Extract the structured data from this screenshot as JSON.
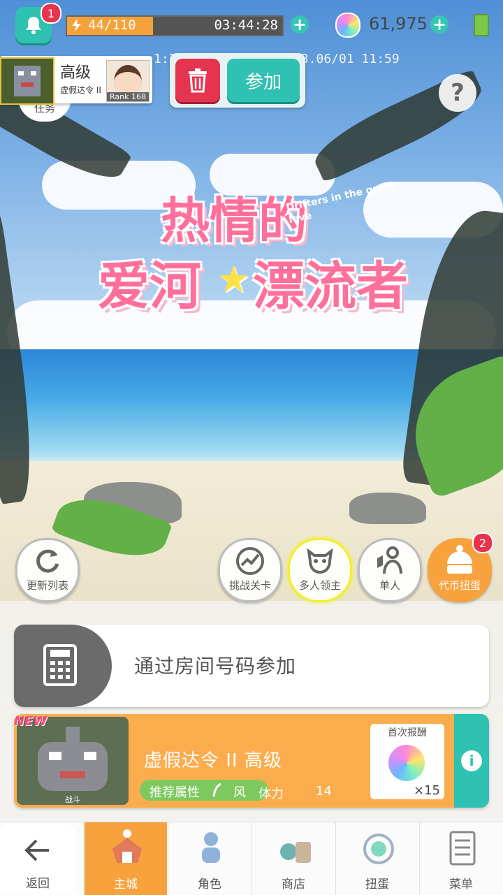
{
  "status": {
    "notification_count": "1",
    "stamina": "44/110",
    "stamina_fraction": 0.4,
    "stamina_timer": "03:44:28",
    "gems": "61,975"
  },
  "room": {
    "difficulty": "高级",
    "quest_name": "虚假达令 II",
    "host_rank": "Rank 168",
    "tasks_tab": "任务",
    "delete_label": "删除",
    "join_label": "参加",
    "time_left": "1:2",
    "timestamp": "23.06/01 11:59",
    "help": "?"
  },
  "event": {
    "logo_line1": "热情的",
    "logo_line2a": "爱河",
    "logo_line2b": "漂流者",
    "logo_english": "Drifters in the great love"
  },
  "actions": {
    "refresh": "更新列表",
    "challenge": "挑战关卡",
    "multi_boss": "多人领主",
    "solo": "单人",
    "token_gacha": "代币扭蛋",
    "token_gacha_badge": "2"
  },
  "room_code": {
    "label": "通过房间号码参加"
  },
  "quest": {
    "new_tag": "NEW",
    "image_caption": "战斗",
    "title": "虚假达令 II 高级",
    "recommended_label": "推荐属性",
    "element": "风",
    "stamina_label": "体力",
    "stamina_cost": "14",
    "reward_label": "首次报酬",
    "reward_count": "×15"
  },
  "nav": {
    "back": "返回",
    "home": "主城",
    "character": "角色",
    "shop": "商店",
    "gacha": "扭蛋",
    "menu": "菜单"
  }
}
